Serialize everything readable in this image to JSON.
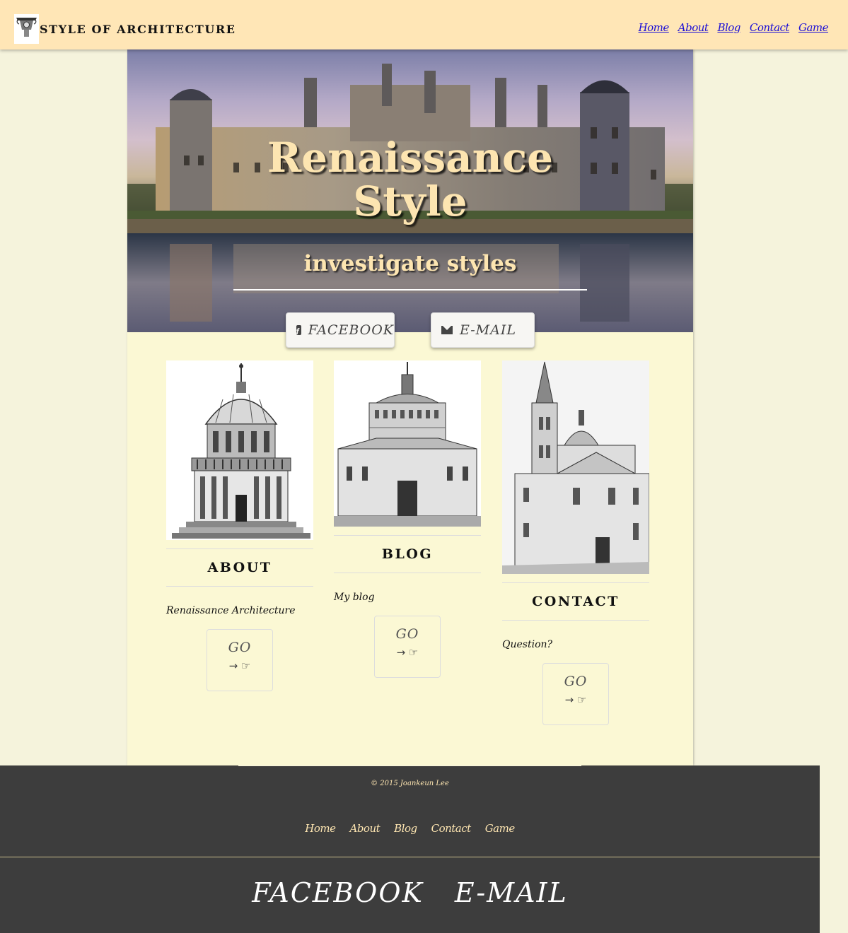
{
  "navbar": {
    "brand": "STYLE OF ARCHITECTURE",
    "links": [
      "Home",
      "About",
      "Blog",
      "Contact",
      "Game"
    ]
  },
  "hero": {
    "title_line1": "Renaissance",
    "title_line2": "Style",
    "subtitle": "investigate styles"
  },
  "social": {
    "facebook": "FACEBOOK",
    "email": "E-MAIL"
  },
  "cards": [
    {
      "heading": "ABOUT",
      "text": "Renaissance Architecture",
      "button": "GO"
    },
    {
      "heading": "BLOG",
      "text": "My blog",
      "button": "GO"
    },
    {
      "heading": "CONTACT",
      "text": "Question?",
      "button": "GO"
    }
  ],
  "go_icons": "→ ☞",
  "footer": {
    "copyright": "© 2015 Joankeun Lee",
    "links": [
      "Home",
      "About",
      "Blog",
      "Contact",
      "Game"
    ],
    "social": [
      "FACEBOOK",
      "E-MAIL"
    ]
  },
  "colors": {
    "navbar_bg": "#ffe6b6",
    "page_bg": "#f5f3dc",
    "panel_bg": "#fbf8d4",
    "footer_bg": "#3d3d3d",
    "accent_text": "#fde5b1",
    "nav_link": "#1a0dd6"
  }
}
